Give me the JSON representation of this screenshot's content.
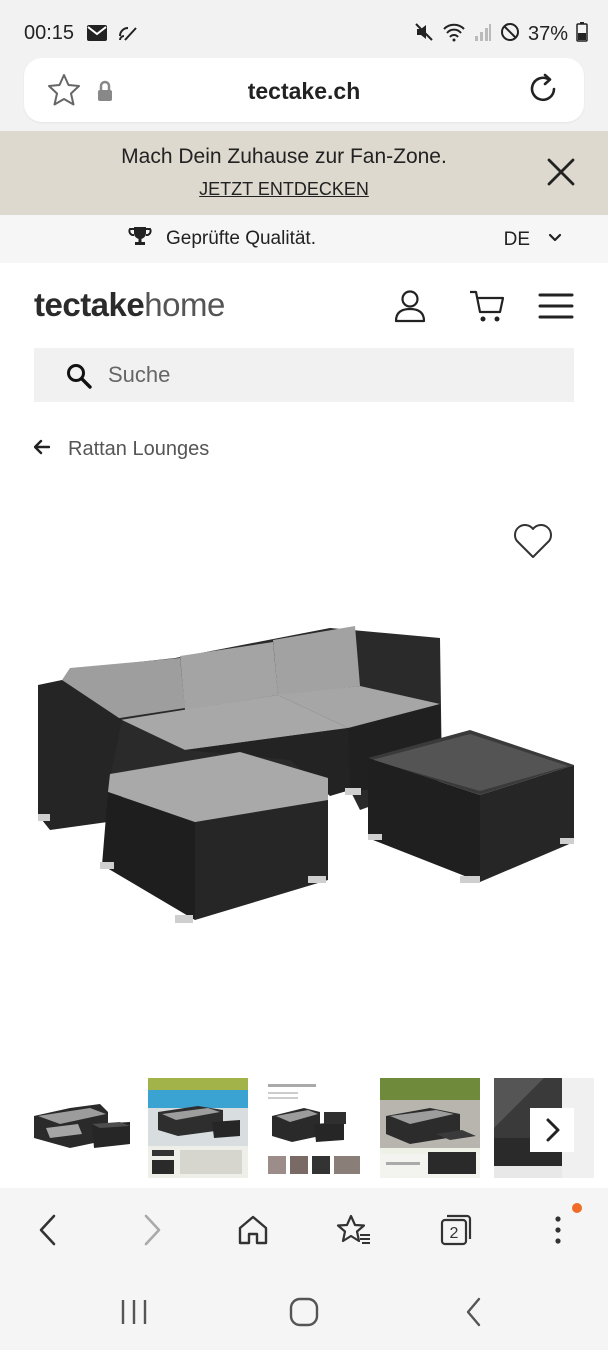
{
  "status_bar": {
    "time": "00:15",
    "battery": "37%"
  },
  "browser": {
    "url": "tectake.ch"
  },
  "promo": {
    "text": "Mach Dein Zuhause zur Fan-Zone.",
    "link": "JETZT ENTDECKEN"
  },
  "quality": {
    "text": "Geprüfte Qualität.",
    "language": "DE"
  },
  "header": {
    "logo_bold": "tectake",
    "logo_light": "home"
  },
  "search": {
    "placeholder": "Suche"
  },
  "breadcrumb": {
    "label": "Rattan Lounges"
  },
  "product": {
    "thumbnail_count": 5
  },
  "icons": [
    "mail-icon",
    "cast-icon",
    "mute-icon",
    "wifi-icon",
    "signal-icon",
    "dnd-icon",
    "battery-icon",
    "star-icon",
    "lock-icon",
    "reload-icon",
    "close-icon",
    "trophy-icon",
    "chevron-down-icon",
    "user-icon",
    "cart-icon",
    "menu-icon",
    "search-icon",
    "arrow-left-icon",
    "heart-icon",
    "chevron-right-icon",
    "back-icon",
    "forward-icon",
    "home-icon",
    "bookmarks-icon",
    "tabs-icon",
    "more-icon",
    "recents-icon",
    "android-home-icon",
    "android-back-icon"
  ],
  "colors": {
    "promo_bg": "#ddd9cf",
    "notification_dot": "#f06a28",
    "cushion": "#9a9a9a",
    "rattan": "#262626"
  },
  "browser_bottom": {
    "tab_count": "2"
  }
}
